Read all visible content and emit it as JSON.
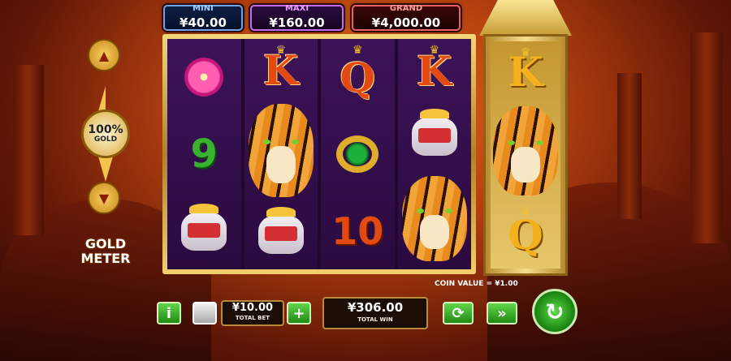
{
  "jackpots": {
    "mini": {
      "label": "MINI",
      "value": "¥40.00"
    },
    "maxi": {
      "label": "MAXI",
      "value": "¥160.00"
    },
    "grand": {
      "label": "GRAND",
      "value": "¥4,000.00"
    }
  },
  "reels": [
    [
      "lily-flower",
      "9",
      "treasure-pot"
    ],
    [
      "K",
      "tiger",
      "treasure-pot"
    ],
    [
      "Q",
      "emerald-ring",
      "10"
    ],
    [
      "K",
      "treasure-pot",
      "tiger"
    ]
  ],
  "tower_reel": [
    "K",
    "tiger",
    "Q"
  ],
  "symbols": {
    "k": "K",
    "q": "Q",
    "nine": "9",
    "ten": "10"
  },
  "gold_meter": {
    "percent": "100%",
    "sub": "GOLD",
    "title_line1": "GOLD",
    "title_line2": "METER",
    "up": "▲",
    "down": "▼"
  },
  "coin_value": "COIN VALUE = ¥1.00",
  "controls": {
    "info": "i",
    "minus": "",
    "total_bet_value": "¥10.00",
    "total_bet_label": "TOTAL BET",
    "plus": "+",
    "total_win_value": "¥306.00",
    "total_win_label": "TOTAL WIN",
    "autoplay": "⟳",
    "turbo": "»",
    "spin": "↻"
  },
  "colors": {
    "accent_green": "#2ea31f",
    "gold": "#f1cf6b",
    "reel_bg": "#2b0a40"
  }
}
